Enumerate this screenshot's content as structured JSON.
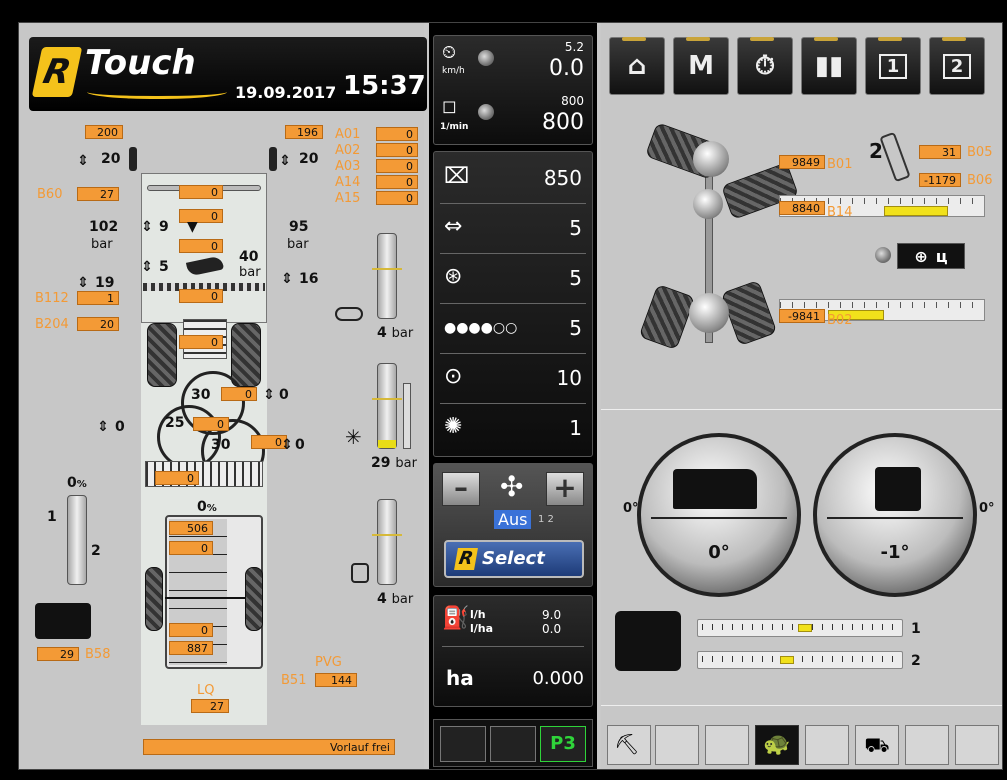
{
  "header": {
    "brand": "Touch",
    "date": "19.09.2017",
    "time": "15:37"
  },
  "left": {
    "top_values": {
      "b200": "200",
      "b196": "196"
    },
    "a_labels": [
      "A01",
      "A02",
      "A03",
      "A14",
      "A15"
    ],
    "a_values": [
      "0",
      "0",
      "0",
      "0",
      "0"
    ],
    "heights": {
      "left_arrow": "20",
      "right_arrow": "20"
    },
    "b60": {
      "label": "B60",
      "value": "27"
    },
    "chain_vals": [
      "0",
      "0",
      "0",
      "0",
      "0"
    ],
    "pressure_left": {
      "value": "102",
      "unit": "bar"
    },
    "pressure_right": {
      "value": "95",
      "unit": "bar"
    },
    "arrow9": "9",
    "arrow5": "5",
    "beater": {
      "value": "40",
      "unit": "bar"
    },
    "arrow19": "19",
    "arrow16": "16",
    "b112": {
      "label": "B112",
      "value": "1"
    },
    "b204": {
      "label": "B204",
      "value": "20"
    },
    "web_val": "0",
    "ring": {
      "r1": "30",
      "r1v": "0",
      "r1a": "0",
      "r2": "25",
      "r2v": "0",
      "r3": "30",
      "r3v": "0",
      "r3a": "0",
      "left_arrow": "0"
    },
    "elevator": "0",
    "tank": {
      "pct": "0",
      "v1": "506",
      "v2": "0",
      "v3": "0",
      "v4": "887"
    },
    "bunker_pct": "0",
    "scale1": "1",
    "scale2": "2",
    "b58": {
      "label": "B58",
      "value": "29"
    },
    "pvg": {
      "label": "PVG",
      "b51": "B51",
      "value": "144"
    },
    "lq": {
      "label": "LQ",
      "value": "27"
    },
    "sliders": [
      {
        "value": "4",
        "unit": "bar"
      },
      {
        "value": "29",
        "unit": "bar"
      },
      {
        "value": "4",
        "unit": "bar"
      }
    ],
    "status": "Vorlauf frei"
  },
  "middle": {
    "speed": {
      "unit": "km/h",
      "set": "5.2",
      "value": "0.0"
    },
    "rpm": {
      "unit": "1/min",
      "set": "800",
      "value": "800"
    },
    "rows": [
      "850",
      "5",
      "5",
      "5",
      "10",
      "1"
    ],
    "fan": {
      "state": "Aus",
      "steps": "1 2",
      "minus": "–",
      "plus": "+"
    },
    "select": "Select",
    "fuel": {
      "lh": "l/h",
      "lh_val": "9.0",
      "lha": "l/ha",
      "lha_val": "0.0"
    },
    "area": {
      "unit": "ha",
      "value": "0.000"
    },
    "fkey": "P3"
  },
  "right": {
    "nav": [
      "home",
      "M",
      "timer",
      "stats",
      "1",
      "2"
    ],
    "b01": {
      "label": "B01",
      "value": "9849"
    },
    "b05": {
      "label": "B05",
      "value": "31"
    },
    "b06": {
      "label": "B06",
      "value": "-1179"
    },
    "b14": {
      "label": "B14",
      "value": "8840"
    },
    "b02": {
      "label": "B02",
      "value": "-9841"
    },
    "axle_no": "2",
    "gauges": [
      {
        "side": "0°",
        "value": "0°"
      },
      {
        "side": "0°",
        "value": "-1°"
      }
    ],
    "tilt": [
      "1",
      "2"
    ],
    "steering_mode": "ц"
  }
}
